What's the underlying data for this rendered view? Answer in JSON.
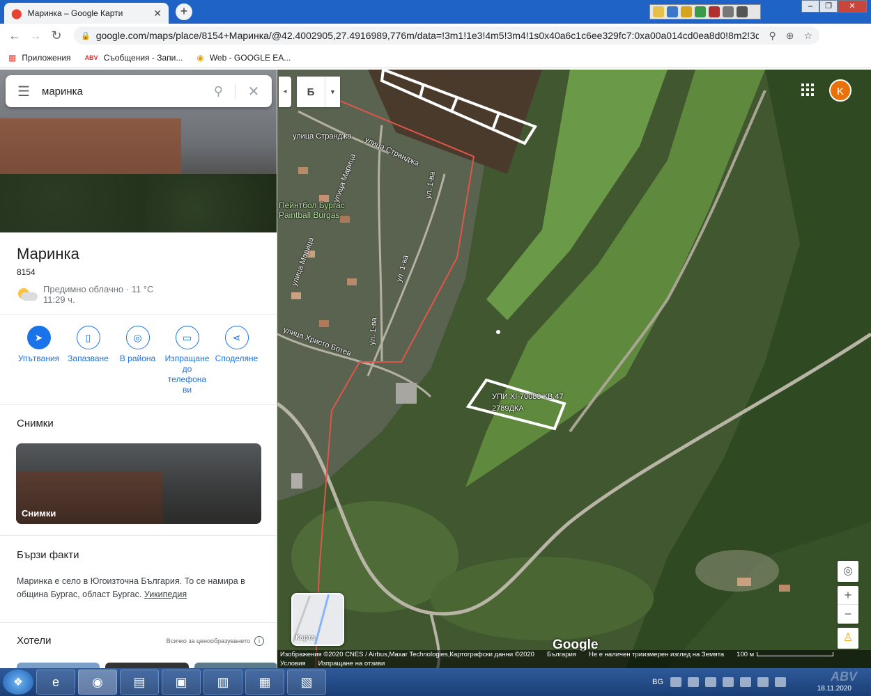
{
  "browser": {
    "tab_title": "Маринка – Google Карти",
    "url": "google.com/maps/place/8154+Маринка/@42.4002905,27.4916989,776m/data=!3m1!1e3!4m5!3m4!1s0x40a6c1c6ee329fc7:0xa00a014cd0ea8d0!8m2!3d...",
    "profile_initial": "K",
    "bookmarks": [
      {
        "label": "Приложения"
      },
      {
        "label": "Съобщения - Запи..."
      },
      {
        "label": "Web - GOOGLE EA..."
      }
    ]
  },
  "search": {
    "value": "маринка"
  },
  "place": {
    "name": "Маринка",
    "postcode": "8154",
    "weather": "Предимно облачно · 11 °C",
    "time": "11:29 ч."
  },
  "actions": [
    {
      "label": "Упътвания"
    },
    {
      "label": "Запазване"
    },
    {
      "label": "В района"
    },
    {
      "label": "Изпращане до телефона ви"
    },
    {
      "label": "Споделяне"
    }
  ],
  "photos": {
    "section_title": "Снимки",
    "thumb_label": "Снимки"
  },
  "quick_facts": {
    "title": "Бързи факти",
    "text": "Маринка е село в Югоизточна България. То се намира в община Бургас, област Бургас.",
    "link": "Уикипедия"
  },
  "hotels": {
    "title": "Хотели",
    "price_link": "Всичко за ценообразуването"
  },
  "map": {
    "layer_label": "Б",
    "labels": {
      "street1": "улица Странджа",
      "street2": "улица Странджа",
      "street3": "улица Марица",
      "street4": "ул. 1-ва",
      "street5": "улица Марица",
      "street6": "ул. 1-ва",
      "street7": "ул. 1-ва",
      "street8": "улица Христо Ботев",
      "paintball1": "Пейнтбол Бургас",
      "paintball2": "Paintball Burgas",
      "plot1": "УПИ XI-70083 КВ.47",
      "plot2": "2789ДКА"
    },
    "minimap_label": "Карта",
    "logo": "Google",
    "attribution": {
      "imagery": "Изображения ©2020 CNES / Airbus,Maxar Technologies,Картографски данни ©2020",
      "country": "България",
      "no3d": "Не е наличен триизмерен изглед на Земята",
      "scale": "100 м",
      "terms": "Условия",
      "feedback": "Изпращане на отзиви"
    }
  },
  "taskbar": {
    "lang": "BG",
    "date": "18.11.2020"
  }
}
